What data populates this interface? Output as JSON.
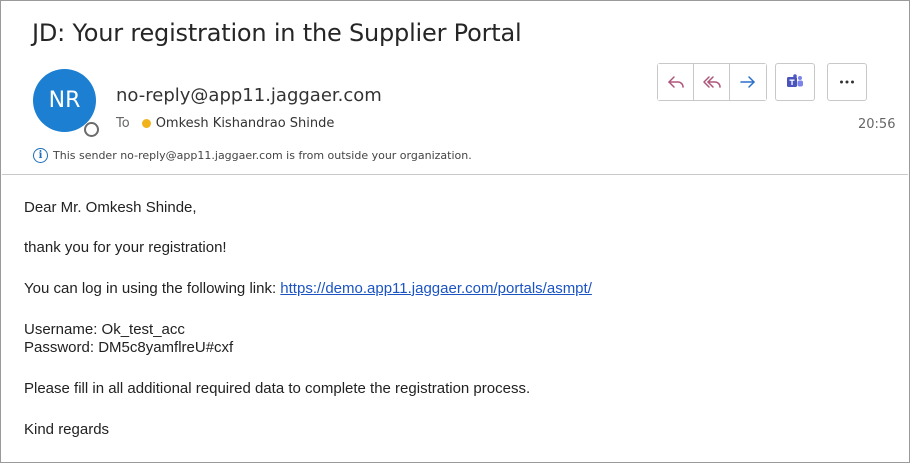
{
  "email": {
    "subject": "JD: Your registration in the Supplier Portal",
    "sender": {
      "initials": "NR",
      "address": "no-reply@app11.jaggaer.com"
    },
    "to_label": "To",
    "recipient": "Omkesh Kishandrao Shinde",
    "time": "20:56",
    "external_notice": "This sender no-reply@app11.jaggaer.com is from outside your organization.",
    "body": {
      "greeting": "Dear Mr. Omkesh Shinde,",
      "thanks": "thank you for your registration!",
      "login_text": "You can log in using the following link: ",
      "login_link": "https://demo.app11.jaggaer.com/portals/asmpt/",
      "username_line": "Username: Ok_test_acc",
      "password_line": "Password: DM5c8yamflreU#cxf",
      "fill_text": "Please fill in all additional required data to complete the registration process.",
      "regards": "Kind regards"
    }
  },
  "actions": {
    "icons": [
      "reply-icon",
      "reply-all-icon",
      "forward-icon",
      "teams-icon",
      "more-icon"
    ],
    "accent": "#b0557a",
    "forward_color": "#2a6fc9",
    "teams_color": "#4b53bc"
  },
  "colors": {
    "avatar": "#1d7fd1",
    "link": "#1b54c2",
    "presence_dot": "#f2b21b"
  }
}
